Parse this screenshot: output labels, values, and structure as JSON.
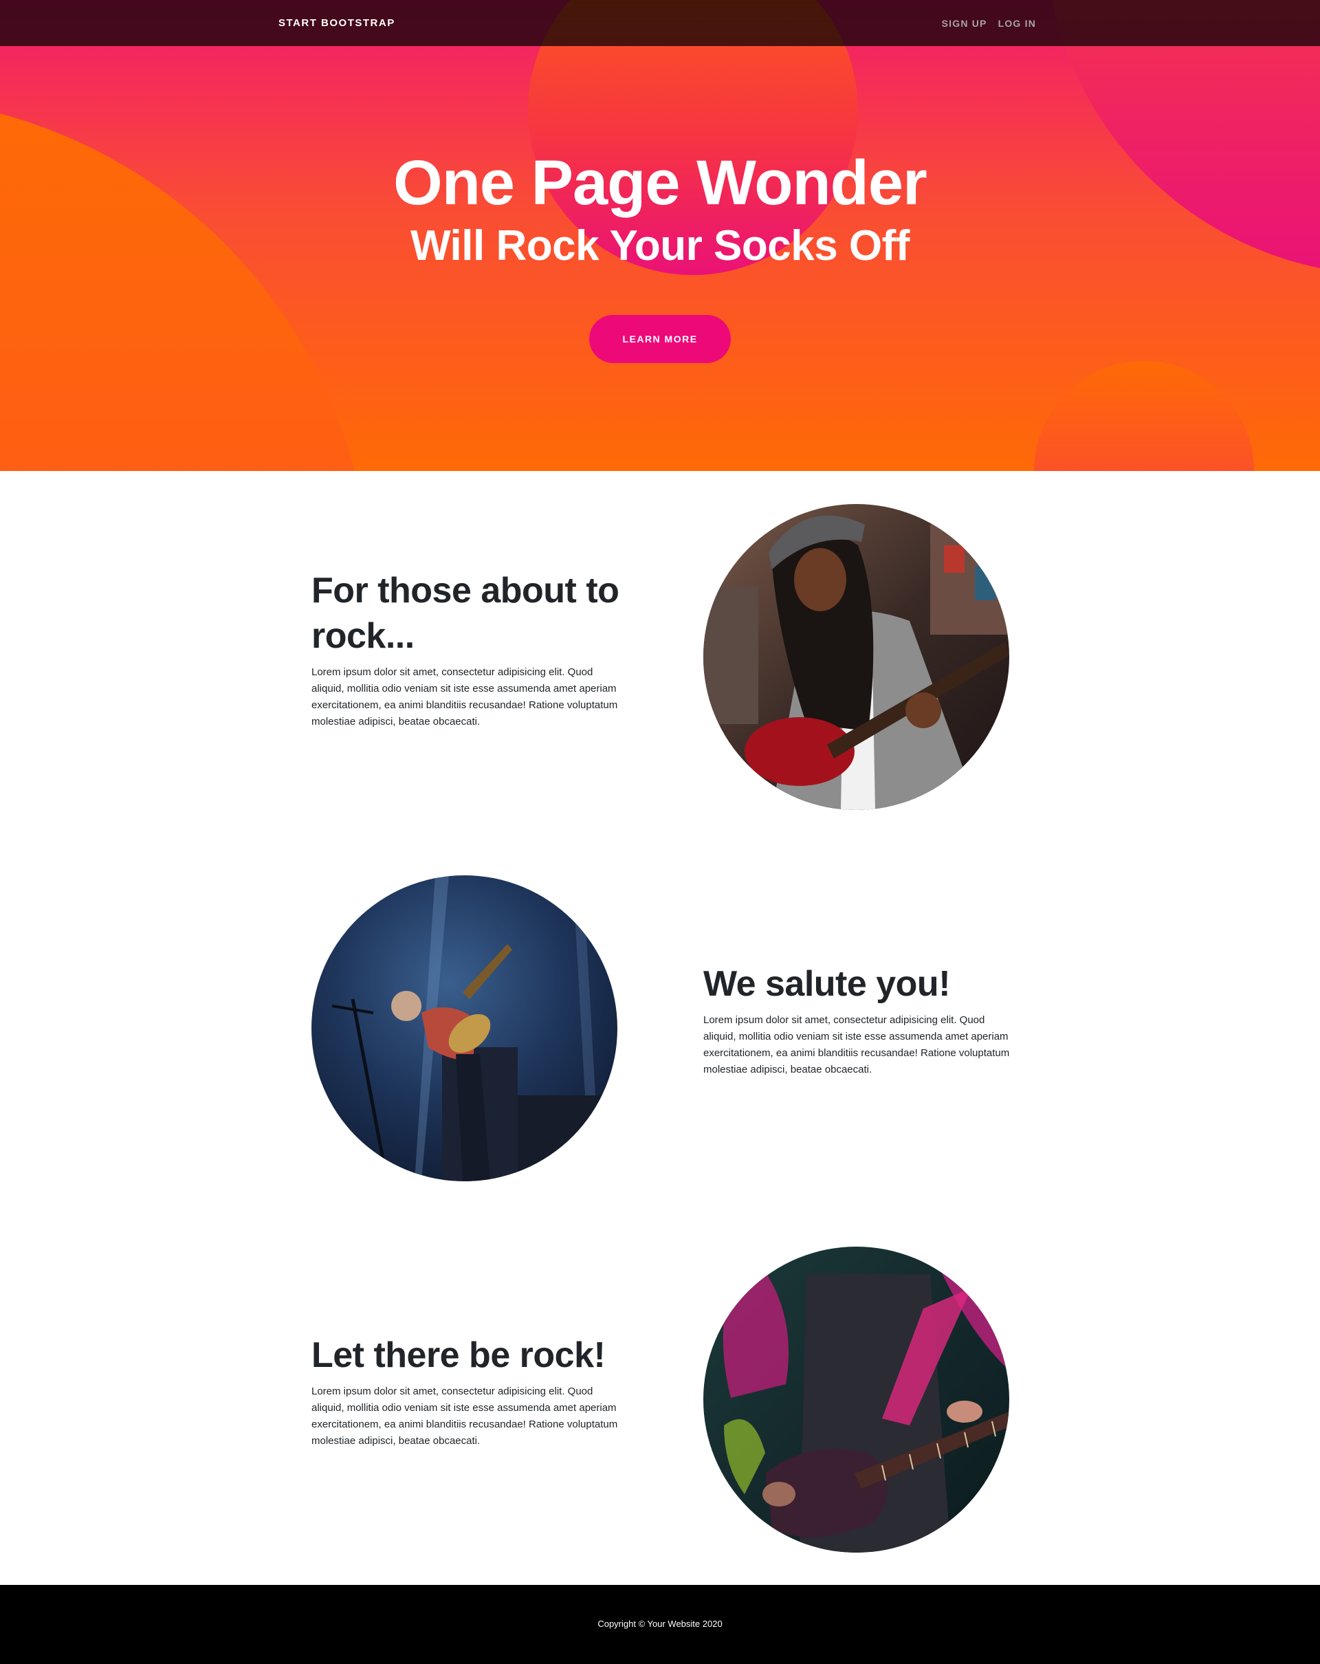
{
  "navbar": {
    "brand": "START BOOTSTRAP",
    "links": [
      "SIGN UP",
      "LOG IN"
    ]
  },
  "hero": {
    "title": "One Page Wonder",
    "subtitle": "Will Rock Your Socks Off",
    "button_label": "LEARN MORE"
  },
  "sections": [
    {
      "heading": "For those about to rock...",
      "body": "Lorem ipsum dolor sit amet, consectetur adipisicing elit. Quod aliquid, mollitia odio veniam sit iste esse assumenda amet aperiam exercitationem, ea animi blanditiis recusandae! Ratione voluptatum molestiae adipisci, beatae obcaecati.",
      "image_icon": "guitarist-woman-photo"
    },
    {
      "heading": "We salute you!",
      "body": "Lorem ipsum dolor sit amet, consectetur adipisicing elit. Quod aliquid, mollitia odio veniam sit iste esse assumenda amet aperiam exercitationem, ea animi blanditiis recusandae! Ratione voluptatum molestiae adipisci, beatae obcaecati.",
      "image_icon": "concert-guitarist-photo"
    },
    {
      "heading": "Let there be rock!",
      "body": "Lorem ipsum dolor sit amet, consectetur adipisicing elit. Quod aliquid, mollitia odio veniam sit iste esse assumenda amet aperiam exercitationem, ea animi blanditiis recusandae! Ratione voluptatum molestiae adipisci, beatae obcaecati.",
      "image_icon": "guitar-closeup-photo"
    }
  ],
  "footer": {
    "copyright": "Copyright © Your Website 2020"
  },
  "colors": {
    "hero_top": "#f21b6b",
    "hero_bottom": "#ff6a06",
    "button": "#ee0979",
    "footer": "#000000"
  }
}
